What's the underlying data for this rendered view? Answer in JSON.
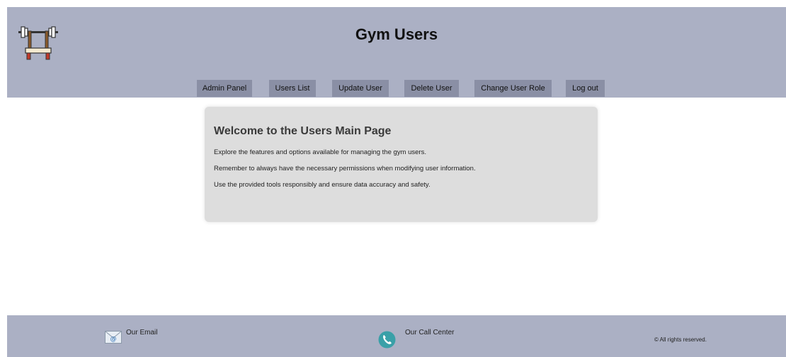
{
  "header": {
    "title": "Gym Users",
    "logo_icon": "barbell-bench-icon"
  },
  "nav": {
    "items": [
      {
        "label": "Admin Panel"
      },
      {
        "label": "Users List"
      },
      {
        "label": "Update User"
      },
      {
        "label": "Delete User"
      },
      {
        "label": "Change User Role"
      },
      {
        "label": "Log out"
      }
    ]
  },
  "main": {
    "title": "Welcome to the Users Main Page",
    "lines": [
      "Explore the features and options available for managing the gym users.",
      "Remember to always have the necessary permissions when modifying user information.",
      "Use the provided tools responsibly and ensure data accuracy and safety."
    ]
  },
  "footer": {
    "email_label": "Our Email",
    "email_icon": "email-icon",
    "call_label": "Our Call Center",
    "call_icon": "phone-icon",
    "copyright": "© All rights reserved."
  },
  "colors": {
    "header_bg": "#abb0c4",
    "nav_button": "#8a8fa5",
    "card_bg": "#dddddd",
    "phone_icon": "#3aa0a8"
  }
}
